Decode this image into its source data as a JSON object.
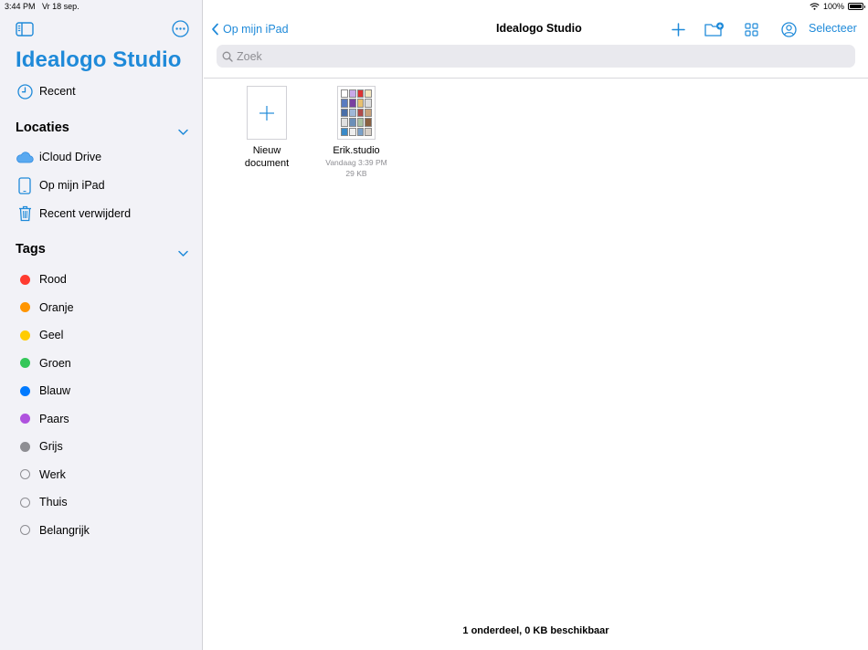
{
  "status": {
    "time": "3:44 PM",
    "date": "Vr 18 sep.",
    "battery": "100%",
    "battery_level": 1.0
  },
  "sidebar": {
    "app_title": "Idealogo Studio",
    "recent": {
      "label": "Recent",
      "icon": "clock-icon"
    },
    "locations": {
      "title": "Locaties",
      "items": [
        {
          "label": "iCloud Drive",
          "icon": "icloud-icon"
        },
        {
          "label": "Op mijn iPad",
          "icon": "ipad-icon"
        },
        {
          "label": "Recent verwijderd",
          "icon": "trash-icon"
        }
      ]
    },
    "tags": {
      "title": "Tags",
      "items": [
        {
          "label": "Rood",
          "color": "#ff3b30"
        },
        {
          "label": "Oranje",
          "color": "#ff9500"
        },
        {
          "label": "Geel",
          "color": "#ffcc00"
        },
        {
          "label": "Groen",
          "color": "#34c759"
        },
        {
          "label": "Blauw",
          "color": "#007aff"
        },
        {
          "label": "Paars",
          "color": "#af52de"
        },
        {
          "label": "Grijs",
          "color": "#8e8e93"
        },
        {
          "label": "Werk",
          "color": ""
        },
        {
          "label": "Thuis",
          "color": ""
        },
        {
          "label": "Belangrijk",
          "color": ""
        }
      ]
    }
  },
  "main": {
    "back_label": "Op mijn iPad",
    "title": "Idealogo Studio",
    "select_label": "Selecteer",
    "search_placeholder": "Zoek",
    "new_doc": {
      "line1": "Nieuw",
      "line2": "document"
    },
    "file": {
      "name": "Erik.studio",
      "date": "Vandaag 3:39 PM",
      "size": "29 KB"
    },
    "footer": "1 onderdeel, 0 KB beschikbaar"
  },
  "colors": {
    "accent": "#1f8ad9",
    "sidebar_bg": "#f2f2f7"
  }
}
